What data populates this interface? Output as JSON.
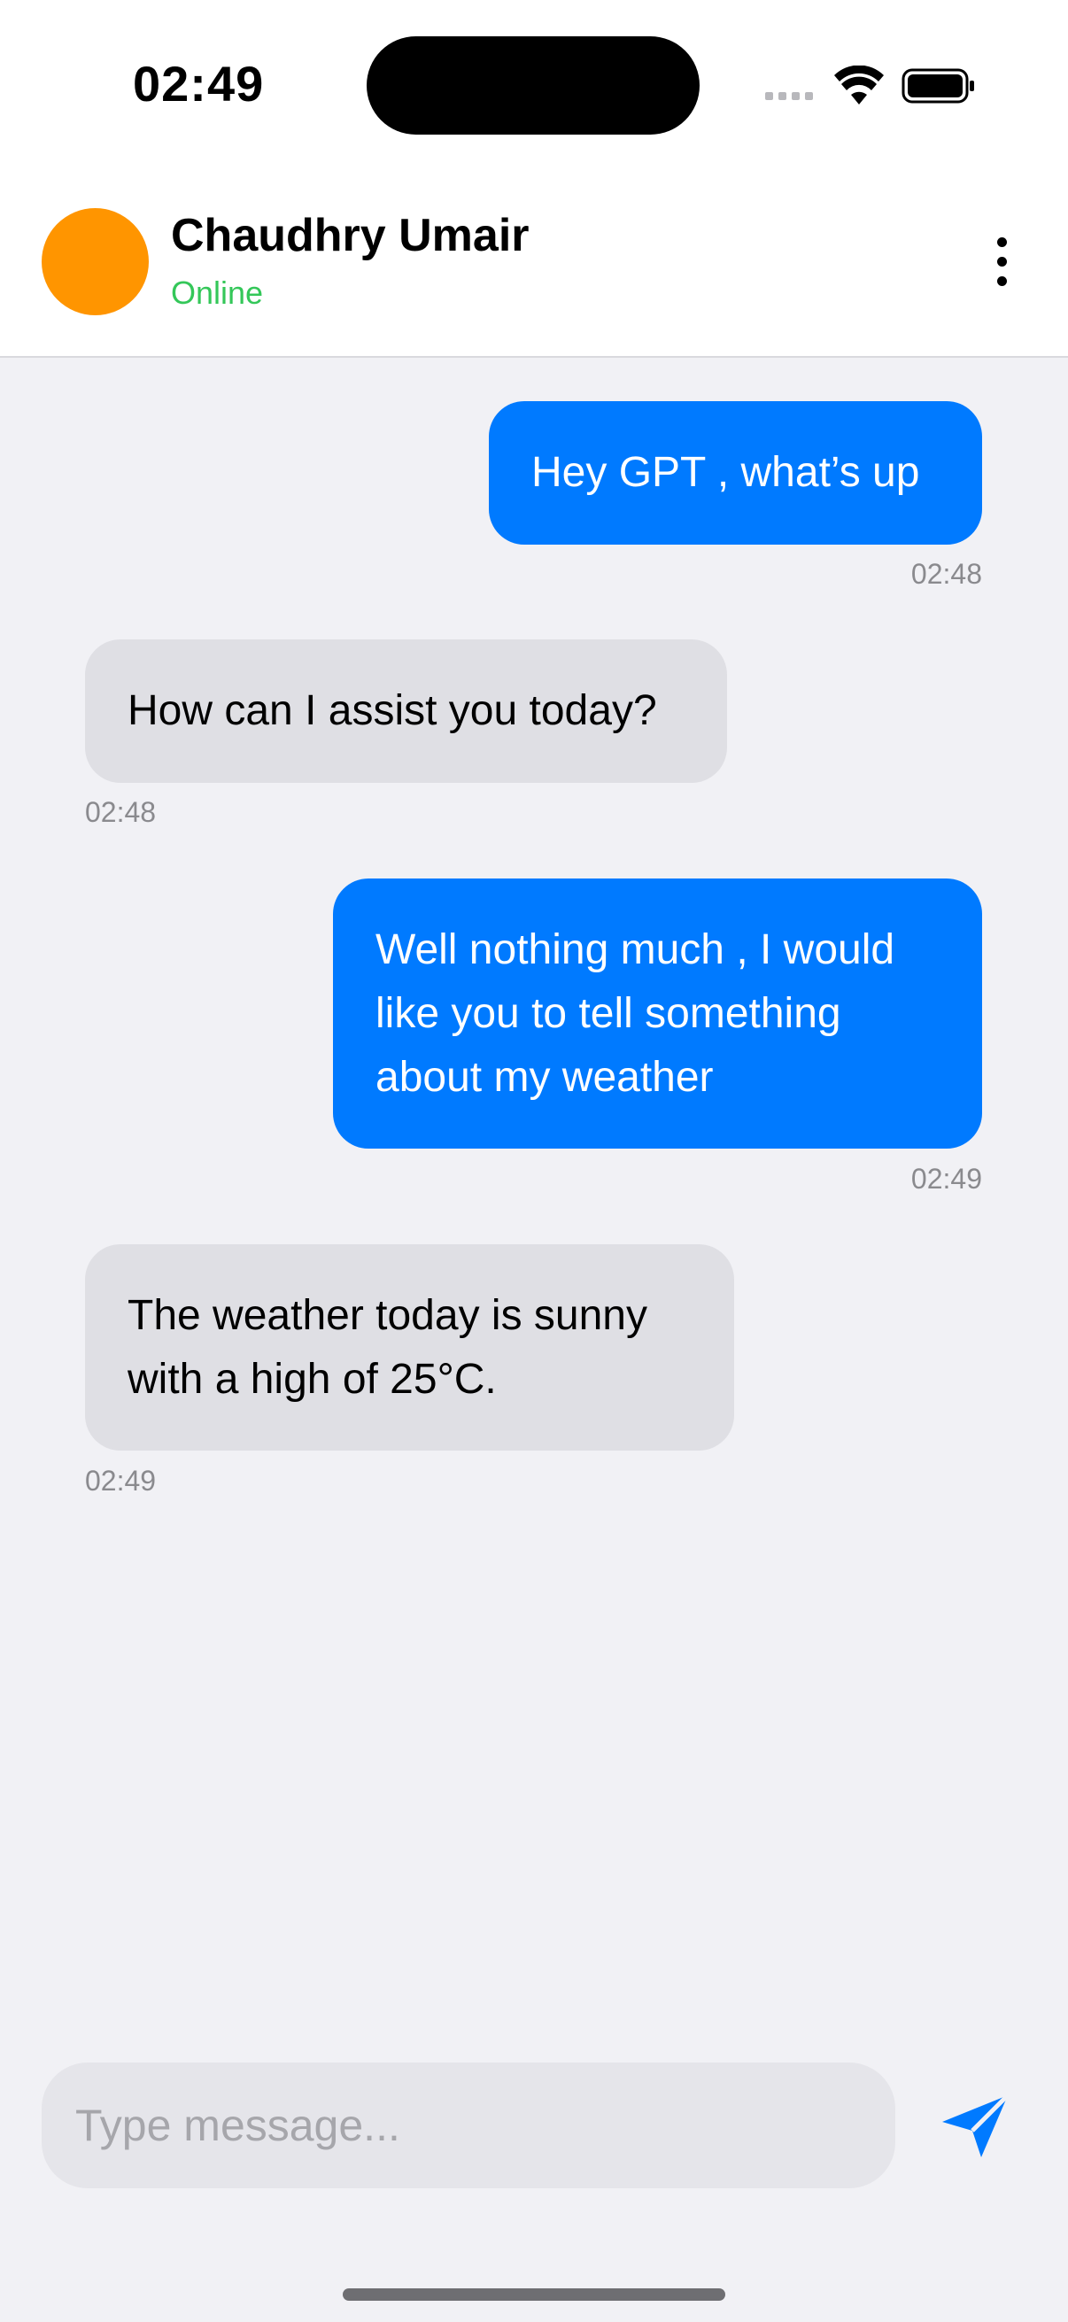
{
  "status_bar": {
    "time": "02:49"
  },
  "header": {
    "contact_name": "Chaudhry Umair",
    "contact_status": "Online",
    "avatar_color": "#ff9500",
    "status_color": "#34c759",
    "menu_icon": "more-vertical-icon"
  },
  "messages": [
    {
      "direction": "outgoing",
      "text": "Hey GPT , what’s up",
      "time": "02:48"
    },
    {
      "direction": "incoming",
      "text": "How can I assist you today?",
      "time": "02:48"
    },
    {
      "direction": "outgoing",
      "text": "Well nothing much , I would like you to tell something about my weather",
      "time": "02:49"
    },
    {
      "direction": "incoming",
      "text": "The weather today is sunny with a high of 25°C.",
      "time": "02:49"
    }
  ],
  "composer": {
    "placeholder": "Type message...",
    "value": "",
    "send_icon": "send-icon"
  },
  "colors": {
    "outgoing_bubble": "#007aff",
    "incoming_bubble": "#dfdfe4",
    "background": "#f1f1f5"
  }
}
